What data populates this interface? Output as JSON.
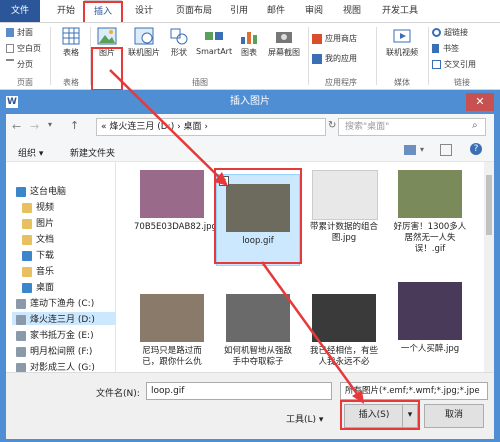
{
  "ribbon": {
    "tabs": [
      "文件",
      "开始",
      "插入",
      "设计",
      "页面布局",
      "引用",
      "邮件",
      "审阅",
      "视图",
      "开发工具"
    ],
    "active_tab": "插入",
    "buttons": {
      "cover": "封面",
      "blank_page": "空白页",
      "page_break": "分页",
      "table": "表格",
      "picture": "图片",
      "online_picture": "联机图片",
      "shapes": "形状",
      "smartart": "SmartArt",
      "chart": "图表",
      "screenshot": "屏幕截图",
      "app_store": "应用商店",
      "my_apps": "我的应用",
      "online_video": "联机视频",
      "hyperlink": "超链接",
      "bookmark": "书签",
      "cross_ref": "交叉引用"
    },
    "groups": {
      "pages": "页面",
      "tables": "表格",
      "illustrations": "插图",
      "apps": "应用程序",
      "media": "媒体",
      "links": "链接"
    }
  },
  "dialog": {
    "title": "插入图片",
    "address": "«  烽火连三月 (D:)  ›  桌面  ›",
    "search_placeholder": "搜索\"桌面\"",
    "organize": "组织 ▾",
    "new_folder": "新建文件夹",
    "nav": [
      "这台电脑",
      "视频",
      "图片",
      "文档",
      "下载",
      "音乐",
      "桌面",
      "莲动下渔舟 (C:)",
      "烽火连三月 (D:)",
      "家书抵万金 (E:)",
      "明月松间照 (F:)",
      "对影成三人 (G:)"
    ],
    "files": [
      {
        "name": "70B5E03DAB82.jpg",
        "color": "#9a6a8a"
      },
      {
        "name": "loop.gif",
        "color": "#6d6a5e"
      },
      {
        "name": "带累计数据的组合图.jpg",
        "color": "#e8e8e8"
      },
      {
        "name": "好厉害！1300多人居然无一人失误！.gif",
        "color": "#7b8a5a"
      },
      {
        "name": "尼玛只是路过而已，跟你什么仇",
        "color": "#8a7a6a"
      },
      {
        "name": "如何机智地从强敌手中夺取粽子",
        "color": "#6a6a6a"
      },
      {
        "name": "我已经相信，有些人我永远不必",
        "color": "#3a3a3a"
      },
      {
        "name": "一个人买醉.jpg",
        "color": "#4a3a5a"
      }
    ],
    "filename_label": "文件名(N):",
    "filename_value": "loop.gif",
    "filetype_value": "所有图片(*.emf;*.wmf;*.jpg;*.jpe",
    "tools_label": "工具(L)  ▾",
    "insert_label": "插入(S)",
    "cancel_label": "取消"
  },
  "colors": {
    "accent": "#2b579a",
    "dialog_frame": "#4f8ed3",
    "highlight": "#e63a3a",
    "selection": "#cce8ff"
  }
}
